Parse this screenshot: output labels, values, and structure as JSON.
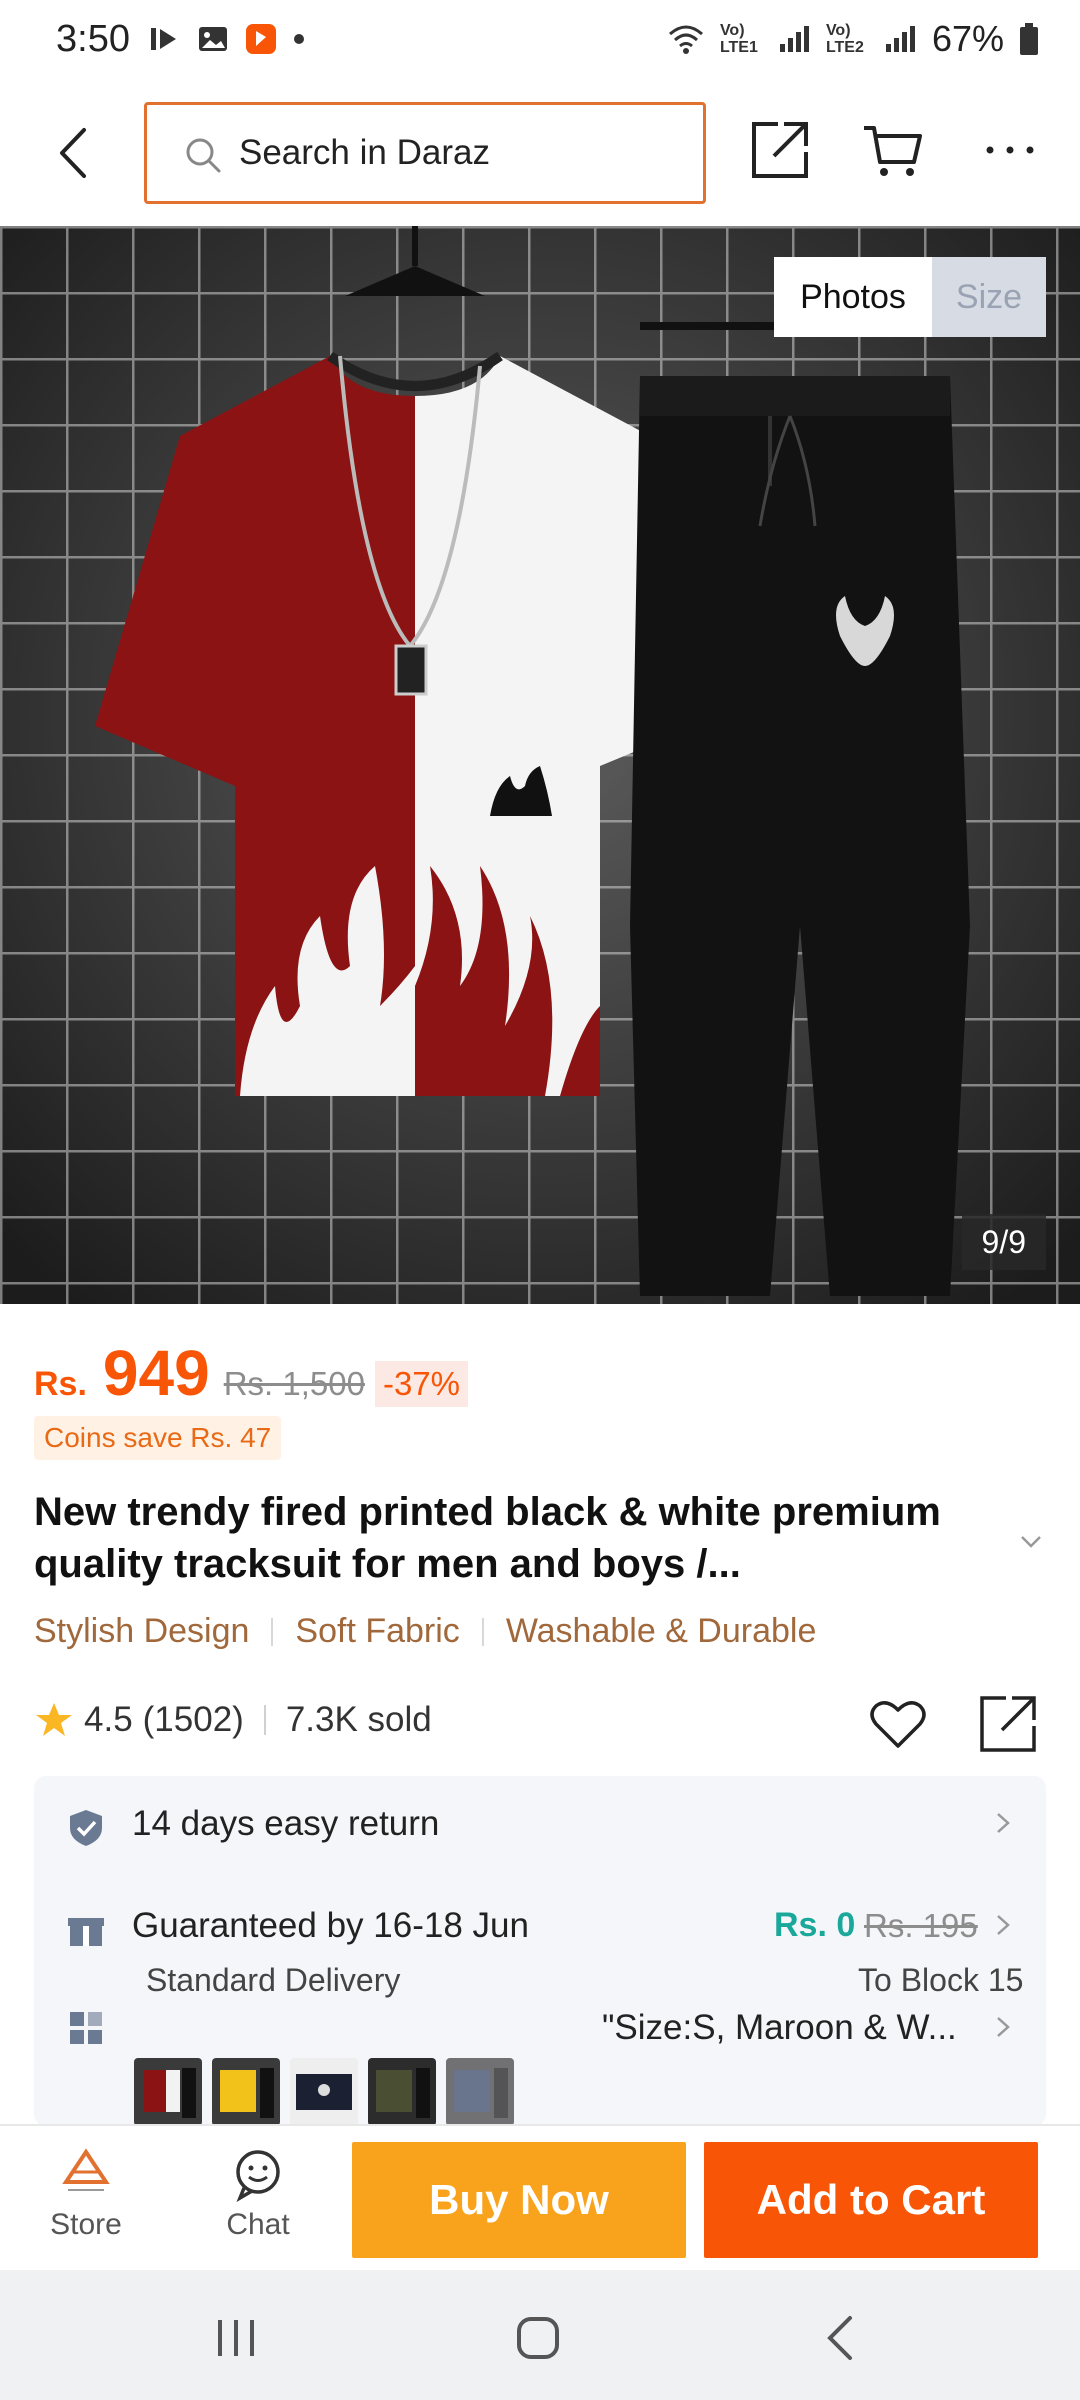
{
  "status_bar": {
    "time": "3:50",
    "battery": "67%",
    "sim1": "Vo) LTE1",
    "sim2": "Vo) LTE2",
    "icons": [
      "media-play-icon",
      "gallery-icon",
      "daraz-app-icon",
      "dot-icon",
      "wifi-icon",
      "signal-icon",
      "battery-icon"
    ]
  },
  "top_nav": {
    "search_placeholder": "Search in Daraz",
    "icons": [
      "back-icon",
      "search-icon",
      "share-icon",
      "cart-icon",
      "more-icon"
    ]
  },
  "gallery": {
    "tabs": [
      "Photos",
      "Size"
    ],
    "active_tab": "Photos",
    "counter": "9/9"
  },
  "price": {
    "prefix": "Rs.",
    "current": "949",
    "original": "Rs. 1,500",
    "discount": "-37%",
    "coins": "Coins save Rs. 47"
  },
  "product": {
    "title": "New trendy fired printed black & white premium quality tracksuit for men and boys /...",
    "features": [
      "Stylish Design",
      "Soft Fabric",
      "Washable & Durable"
    ],
    "rating": "4.5",
    "reviews": "(1502)",
    "sold": "7.3K sold"
  },
  "services": {
    "return_policy": "14 days easy return",
    "delivery_guarantee": "Guaranteed by 16-18 Jun",
    "delivery_type": "Standard Delivery",
    "shipping_fee": "Rs. 0",
    "shipping_fee_original": "Rs. 195",
    "delivery_location": "To Block 15",
    "variant_selected": "\"Size:S, Maroon & W...",
    "variant_thumbs": [
      "maroon-white",
      "yellow-black",
      "navy",
      "olive",
      "blue-grey"
    ]
  },
  "actions": {
    "store_label": "Store",
    "chat_label": "Chat",
    "buy_now": "Buy Now",
    "add_to_cart": "Add to Cart"
  },
  "colors": {
    "brand_orange": "#f85606",
    "buy_now_yellow": "#f9a21c",
    "feature_brown": "#a0683b",
    "free_shipping_teal": "#1aa89a"
  }
}
